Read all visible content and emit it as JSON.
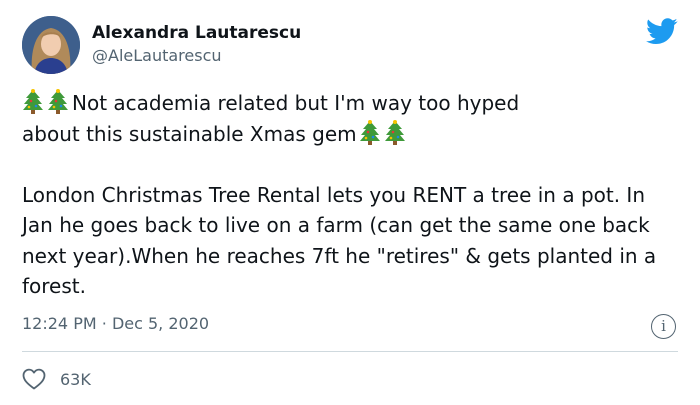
{
  "author": {
    "display_name": "Alexandra Lautarescu",
    "handle": "@AleLautarescu"
  },
  "tweet": {
    "line1_text": "Not academia related but I'm way too hyped",
    "line2_text": "about this sustainable Xmas gem",
    "paragraph2": "London Christmas Tree Rental lets you RENT a tree in a pot. In Jan he goes back to live on a farm (can get the same one back next year).When he reaches 7ft he \"retires\" & gets planted in a forest.",
    "time": "12:24 PM",
    "separator": "·",
    "date": "Dec 5, 2020"
  },
  "actions": {
    "likes": "63K",
    "info_glyph": "i"
  },
  "icons": {
    "brand": "twitter-bird-icon",
    "tree": "christmas-tree-icon",
    "like": "heart-icon",
    "info": "info-icon"
  },
  "colors": {
    "brand": "#1d9bf0",
    "text": "#0f1419",
    "secondary": "#536471",
    "divider": "#cfd9de"
  }
}
